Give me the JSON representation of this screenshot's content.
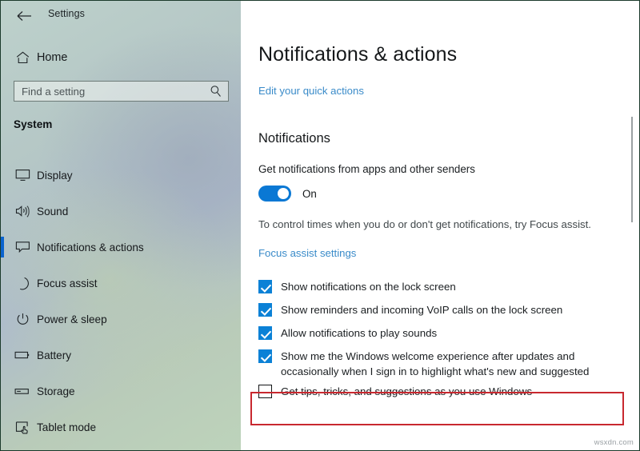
{
  "window": {
    "app_title": "Settings",
    "back_icon": "back-arrow-icon",
    "controls": {
      "minimize": "–",
      "maximize": "□",
      "close": "✕"
    }
  },
  "sidebar": {
    "home": {
      "label": "Home",
      "icon": "home-icon"
    },
    "search": {
      "value": "",
      "placeholder": "Find a setting",
      "icon": "search-icon"
    },
    "group_header": "System",
    "items": [
      {
        "label": "Display",
        "icon": "monitor-icon",
        "active": false
      },
      {
        "label": "Sound",
        "icon": "speaker-icon",
        "active": false
      },
      {
        "label": "Notifications & actions",
        "icon": "notification-icon",
        "active": true
      },
      {
        "label": "Focus assist",
        "icon": "moon-icon",
        "active": false
      },
      {
        "label": "Power & sleep",
        "icon": "power-icon",
        "active": false
      },
      {
        "label": "Battery",
        "icon": "battery-icon",
        "active": false
      },
      {
        "label": "Storage",
        "icon": "storage-icon",
        "active": false
      },
      {
        "label": "Tablet mode",
        "icon": "tablet-icon",
        "active": false
      }
    ]
  },
  "main": {
    "page_title": "Notifications & actions",
    "quick_actions_link": "Edit your quick actions",
    "section_header": "Notifications",
    "get_notifications_label": "Get notifications from apps and other senders",
    "toggle_state": "On",
    "focus_description": "To control times when you do or don't get notifications, try Focus assist.",
    "focus_link": "Focus assist settings",
    "checkboxes": [
      {
        "label": "Show notifications on the lock screen",
        "checked": true,
        "highlighted": false
      },
      {
        "label": "Show reminders and incoming VoIP calls on the lock screen",
        "checked": true,
        "highlighted": false
      },
      {
        "label": "Allow notifications to play sounds",
        "checked": true,
        "highlighted": false
      },
      {
        "label": "Show me the Windows welcome experience after updates and occasionally when I sign in to highlight what's new and suggested",
        "checked": true,
        "highlighted": false
      },
      {
        "label": "Get tips, tricks, and suggestions as you use Windows",
        "checked": false,
        "highlighted": true
      }
    ]
  },
  "watermark": "wsxdn.com",
  "colors": {
    "accent": "#0a78d4",
    "link": "#3a8bc9",
    "highlight_border": "#c8282f",
    "active_indicator": "#0b63ce"
  }
}
